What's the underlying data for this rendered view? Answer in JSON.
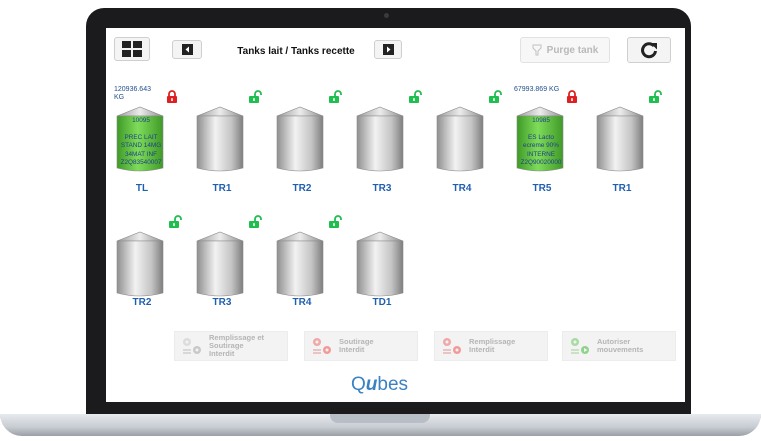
{
  "toolbar": {
    "title": "Tanks lait / Tanks recette",
    "purge_label": "Purge tank"
  },
  "tanks_row1": [
    {
      "label": "TL",
      "weight": "120936.643 KG",
      "lock": "locked",
      "filled": true,
      "content": [
        "10095",
        "PREC LAIT",
        "STAND 14MG",
        "34MAT INF",
        "Z2Q83540007"
      ]
    },
    {
      "label": "TR1",
      "weight": "",
      "lock": "unlocked",
      "filled": false,
      "content": []
    },
    {
      "label": "TR2",
      "weight": "",
      "lock": "unlocked",
      "filled": false,
      "content": []
    },
    {
      "label": "TR3",
      "weight": "",
      "lock": "unlocked",
      "filled": false,
      "content": []
    },
    {
      "label": "TR4",
      "weight": "",
      "lock": "unlocked",
      "filled": false,
      "content": []
    },
    {
      "label": "TR5",
      "weight": "67993.869 KG",
      "lock": "locked",
      "filled": true,
      "content": [
        "10985",
        "ES Lacto",
        "ecreme 90%",
        "INTERNE",
        "Z2Q90020000"
      ]
    },
    {
      "label": "TR1",
      "weight": "",
      "lock": "unlocked",
      "filled": false,
      "content": []
    }
  ],
  "tanks_row2": [
    {
      "label": "TR2",
      "lock": "unlocked"
    },
    {
      "label": "TR3",
      "lock": "unlocked"
    },
    {
      "label": "TR4",
      "lock": "unlocked"
    },
    {
      "label": "TD1",
      "lock": "none"
    }
  ],
  "actions": {
    "fill_drain_forbidden": [
      "Remplissage et",
      "Soutirage",
      "Interdit"
    ],
    "drain_forbidden": [
      "Soutirage",
      "Interdit"
    ],
    "fill_forbidden": [
      "Remplissage",
      "Interdit"
    ],
    "allow_moves": [
      "Autoriser",
      "mouvements"
    ]
  },
  "brand": {
    "pre": "Q",
    "mid": "u",
    "post": "bes"
  },
  "colors": {
    "accent": "#1f5fb0",
    "lock_locked": "#e02020",
    "lock_unlocked": "#1fbf4f",
    "fill": "#58c23a",
    "brand": "#3a82c4"
  },
  "icons": [
    "grid-icon",
    "arrow-left-icon",
    "arrow-right-icon",
    "filter-icon",
    "refresh-icon",
    "padlock-icon",
    "gear-icon"
  ]
}
